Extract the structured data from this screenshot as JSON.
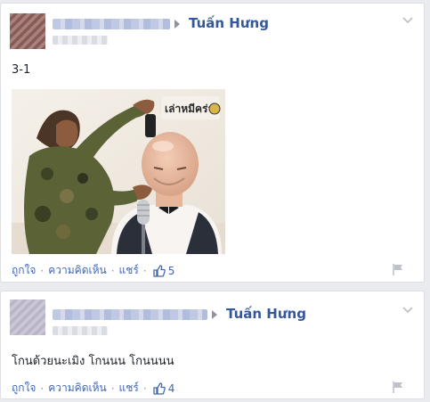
{
  "posts": [
    {
      "actor": "Tuấn Hưng",
      "text": "3-1",
      "actions": {
        "like": "ถูกใจ",
        "comment": "ความคิดเห็น",
        "share": "แชร์",
        "separator": "·"
      },
      "like_count": "5",
      "has_photo": true,
      "photo_watermark": "เล่าหมีคร่า"
    },
    {
      "actor": "Tuấn Hưng",
      "text": "โกนด้วยนะเมิง โกนนน โกนนนน",
      "actions": {
        "like": "ถูกใจ",
        "comment": "ความคิดเห็น",
        "share": "แชร์",
        "separator": "·"
      },
      "like_count": "4",
      "has_photo": false
    }
  ],
  "colors": {
    "link": "#4267b2",
    "actor": "#365899",
    "background": "#e9ebee"
  },
  "icons": {
    "options": "chevron-down-icon",
    "like": "thumbs-up-icon",
    "report": "flag-icon"
  }
}
